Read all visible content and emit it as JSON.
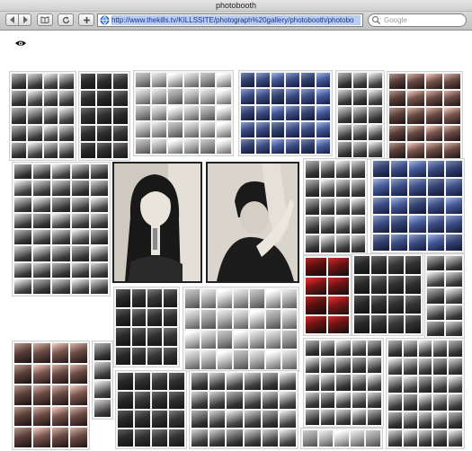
{
  "window": {
    "title": "photobooth"
  },
  "toolbar": {
    "back_icon": "back-arrow-icon",
    "forward_icon": "forward-arrow-icon",
    "bookmarks_icon": "bookmarks-icon",
    "reload_icon": "reload-icon",
    "add_bookmark_icon": "plus-icon"
  },
  "address_bar": {
    "url": "http://www.thekills.tv/KILLSSITE/photograph%20gallery/photobooth/photobo"
  },
  "search": {
    "placeholder": "Google"
  },
  "page": {
    "logo_icon": "kills-eye-logo-icon",
    "collage_description_items": [
      "photobooth strips",
      "large photo left",
      "large photo right"
    ]
  },
  "colors": {
    "chrome": "#cfcfcf",
    "url_highlight": "#b9cdf2",
    "background": "#ffffff"
  }
}
